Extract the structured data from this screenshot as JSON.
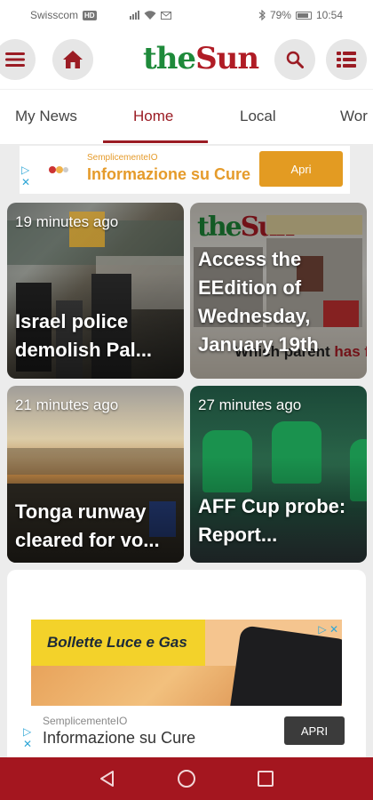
{
  "status_bar": {
    "carrier": "Swisscom",
    "network_badge": "HD",
    "battery": "79%",
    "time": "10:54",
    "icons": [
      "signal-icon",
      "wifi-icon",
      "mail-icon",
      "bluetooth-icon",
      "battery-icon"
    ]
  },
  "header": {
    "logo_the": "the",
    "logo_sun": "Sun",
    "icons": [
      "menu-icon",
      "home-icon",
      "search-icon",
      "list-icon"
    ]
  },
  "tabs": [
    {
      "label": "My News",
      "active": false
    },
    {
      "label": "Home",
      "active": true
    },
    {
      "label": "Local",
      "active": false
    },
    {
      "label": "Wor",
      "active": false
    }
  ],
  "top_ad": {
    "source": "SemplicementeIO",
    "headline": "Informazione su Cure",
    "cta": "Apri"
  },
  "articles": [
    {
      "time": "19 minutes ago",
      "title": "Israel police demolish Pal..."
    },
    {
      "time": "",
      "title": "Access the EEdition of Wednesday, January 19th"
    },
    {
      "time": "21 minutes ago",
      "title": "Tonga runway cleared for vo..."
    },
    {
      "time": "27 minutes ago",
      "title": "AFF Cup probe: Report..."
    }
  ],
  "paper_preview": {
    "logo_the": "the",
    "logo_sun": "Sun",
    "headline_black": "Which parent ",
    "headline_red": "has final say?"
  },
  "mid_ad": {
    "banner_text": "Bollette Luce e Gas"
  },
  "bottom_ad": {
    "source": "SemplicementeIO",
    "headline": "Informazione su Cure",
    "cta": "APRI"
  },
  "nav": [
    "back-icon",
    "home-circle-icon",
    "recents-icon"
  ],
  "colors": {
    "brand_red": "#9b1c24",
    "brand_green": "#1e8a3a",
    "ad_orange": "#e39b22",
    "nav_bar": "#a4161f"
  }
}
